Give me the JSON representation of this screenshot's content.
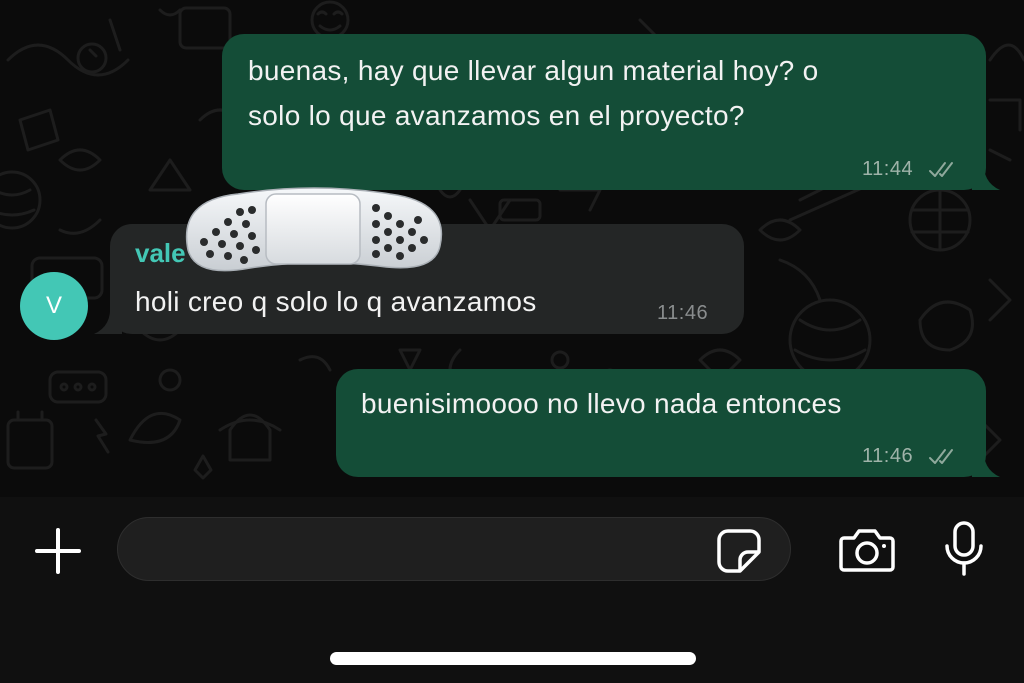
{
  "chat": {
    "messages": [
      {
        "direction": "outgoing",
        "lines": [
          "buenas, hay que llevar algun material hoy? o",
          "solo lo que avanzamos en el proyecto?"
        ],
        "time": "11:44",
        "status": "read"
      },
      {
        "direction": "incoming",
        "sender": "vale",
        "lines": [
          "holi creo q solo lo q avanzamos"
        ],
        "time": "11:46"
      },
      {
        "direction": "outgoing",
        "lines": [
          "buenisimoooo no llevo nada entonces"
        ],
        "time": "11:46",
        "status": "read"
      }
    ],
    "avatar_initial": "V"
  },
  "composer": {
    "text_value": "",
    "icons": {
      "attach": "plus-icon",
      "sticker": "sticker-icon",
      "camera": "camera-icon",
      "voice": "microphone-icon"
    }
  },
  "colors": {
    "outgoing_bubble": "#144d37",
    "incoming_bubble": "#242626",
    "accent": "#43c7b5",
    "background": "#0b0b0b"
  }
}
